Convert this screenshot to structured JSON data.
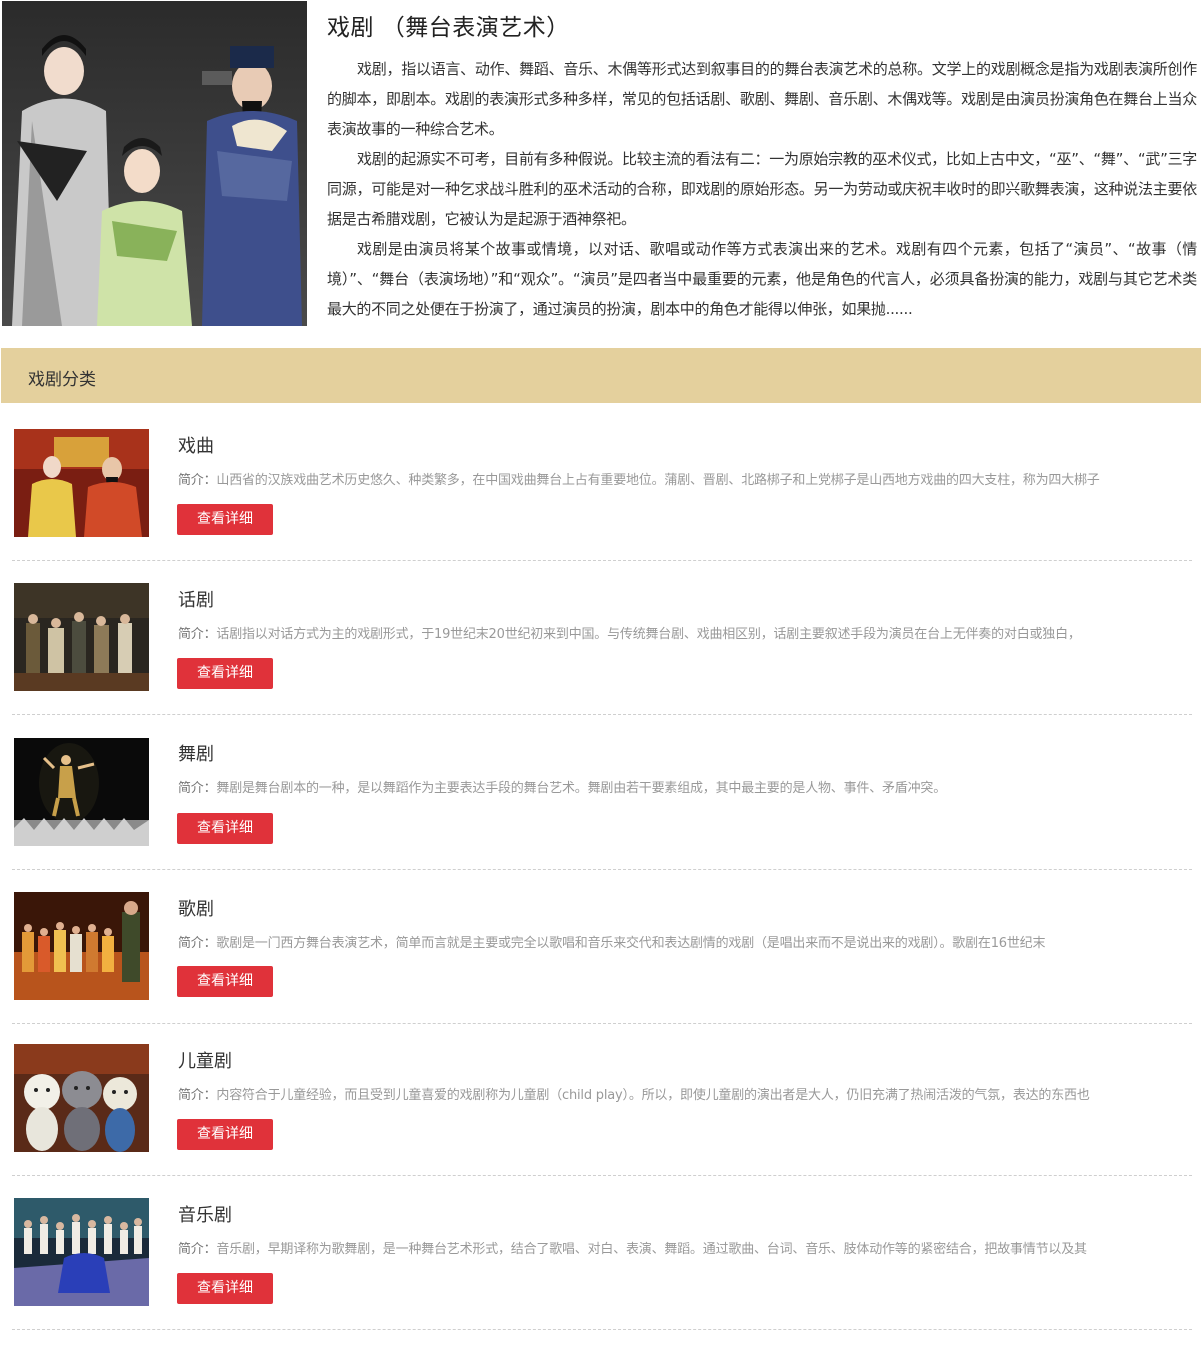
{
  "intro": {
    "title": "戏剧 （舞台表演艺术）",
    "paragraphs": [
      "戏剧，指以语言、动作、舞蹈、音乐、木偶等形式达到叙事目的的舞台表演艺术的总称。文学上的戏剧概念是指为戏剧表演所创作的脚本，即剧本。戏剧的表演形式多种多样，常见的包括话剧、歌剧、舞剧、音乐剧、木偶戏等。戏剧是由演员扮演角色在舞台上当众表演故事的一种综合艺术。",
      "戏剧的起源实不可考，目前有多种假说。比较主流的看法有二：一为原始宗教的巫术仪式，比如上古中文，“巫”、“舞”、“武”三字同源，可能是对一种乞求战斗胜利的巫术活动的合称，即戏剧的原始形态。另一为劳动或庆祝丰收时的即兴歌舞表演，这种说法主要依据是古希腊戏剧，它被认为是起源于酒神祭祀。",
      "戏剧是由演员将某个故事或情境，以对话、歌唱或动作等方式表演出来的艺术。戏剧有四个元素，包括了“演员”、“故事（情境）”、“舞台（表演场地）”和“观众”。“演员”是四者当中最重要的元素，他是角色的代言人，必须具备扮演的能力，戏剧与其它艺术类最大的不同之处便在于扮演了，通过演员的扮演，剧本中的角色才能得以伸张，如果抛......"
    ]
  },
  "categories_header": "戏剧分类",
  "desc_label": "简介：",
  "button_label": "查看详细",
  "categories": [
    {
      "name": "戏曲",
      "desc": "山西省的汉族戏曲艺术历史悠久、种类繁多，在中国戏曲舞台上占有重要地位。蒲剧、晋剧、北路梆子和上党梆子是山西地方戏曲的四大支柱，称为四大梆子"
    },
    {
      "name": "话剧",
      "desc": "话剧指以对话方式为主的戏剧形式，于19世纪末20世纪初来到中国。与传统舞台剧、戏曲相区别，话剧主要叙述手段为演员在台上无伴奏的对白或独白，"
    },
    {
      "name": "舞剧",
      "desc": "舞剧是舞台剧本的一种，是以舞蹈作为主要表达手段的舞台艺术。舞剧由若干要素组成，其中最主要的是人物、事件、矛盾冲突。"
    },
    {
      "name": "歌剧",
      "desc": "歌剧是一门西方舞台表演艺术，简单而言就是主要或完全以歌唱和音乐来交代和表达剧情的戏剧（是唱出来而不是说出来的戏剧）。歌剧在16世纪末"
    },
    {
      "name": "儿童剧",
      "desc": "内容符合于儿童经验，而且受到儿童喜爱的戏剧称为儿童剧（child play）。所以，即使儿童剧的演出者是大人，仍旧充满了热闹活泼的气氛，表达的东西也"
    },
    {
      "name": "音乐剧",
      "desc": "音乐剧，早期译称为歌舞剧，是一种舞台艺术形式，结合了歌唱、对白、表演、舞蹈。通过歌曲、台词、音乐、肢体动作等的紧密结合，把故事情节以及其"
    }
  ]
}
